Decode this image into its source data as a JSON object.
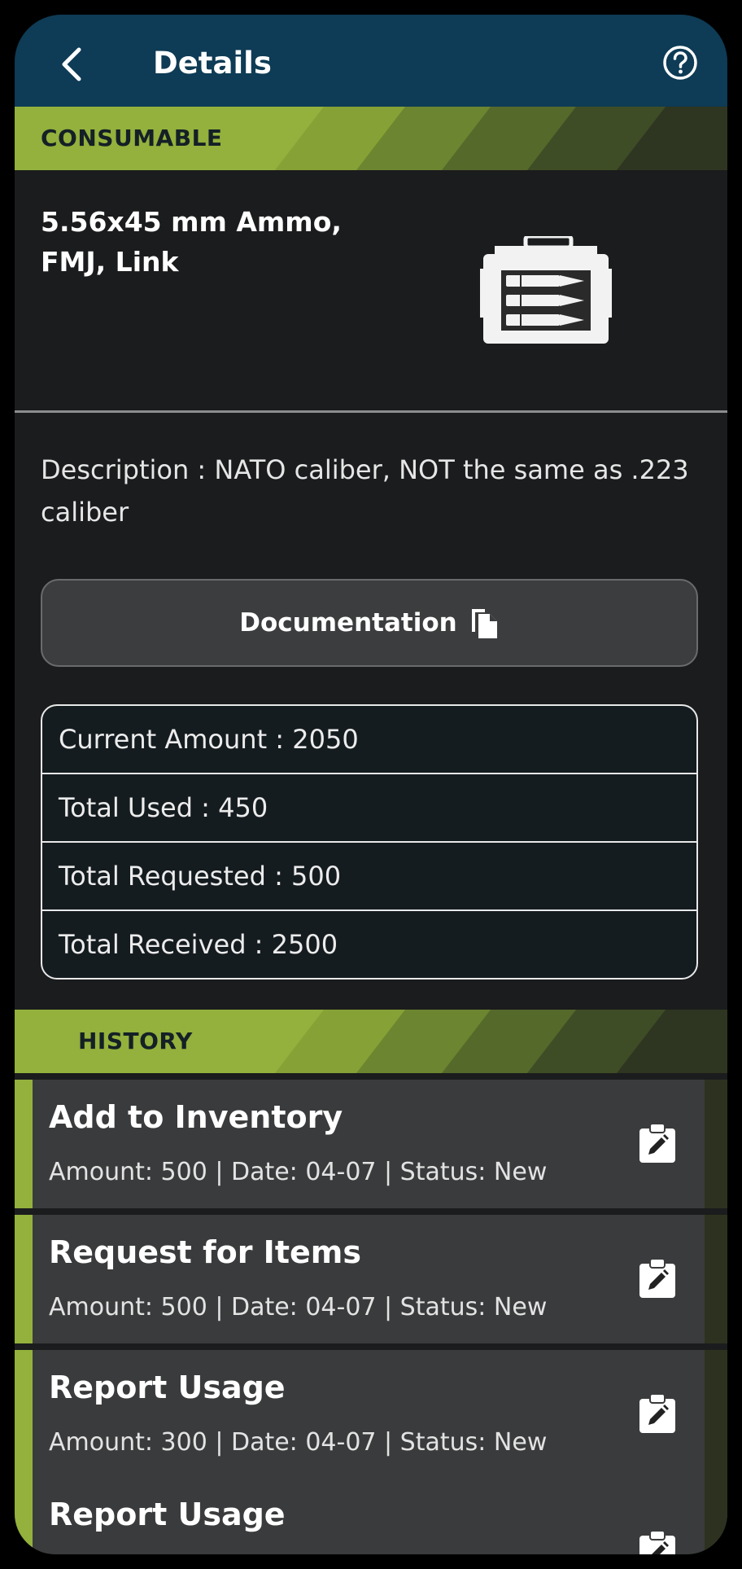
{
  "header": {
    "title": "Details",
    "back_icon": "chevron-left-icon",
    "help_icon": "help-circle-icon"
  },
  "category": {
    "label": "CONSUMABLE"
  },
  "product": {
    "name_line1": "5.56x45 mm Ammo,",
    "name_line2": "FMJ, Link",
    "image_icon": "ammo-crate-icon"
  },
  "description": "Description : NATO caliber, NOT the same as .223 caliber",
  "documentation": {
    "label": "Documentation",
    "icon": "document-copy-icon"
  },
  "stats": [
    "Current Amount : 2050",
    "Total Used : 450",
    "Total Requested : 500",
    "Total Received : 2500"
  ],
  "history": {
    "label": "HISTORY",
    "items": [
      {
        "title": "Add to Inventory",
        "meta": "Amount: 500 | Date: 04-07 | Status: New",
        "icon": "edit-clipboard-icon"
      },
      {
        "title": "Request for Items",
        "meta": "Amount: 500 | Date: 04-07 | Status: New",
        "icon": "edit-clipboard-icon"
      },
      {
        "title": "Report Usage",
        "meta": "Amount: 300 | Date: 04-07 | Status: New",
        "icon": "edit-clipboard-icon"
      },
      {
        "title": "Report Usage",
        "meta": "",
        "icon": "edit-clipboard-icon"
      }
    ]
  },
  "colors": {
    "header_bg": "#0e3b55",
    "accent_green": "#93b13c",
    "background": "#1b1c1d",
    "card_bg": "#3a3b3c"
  }
}
